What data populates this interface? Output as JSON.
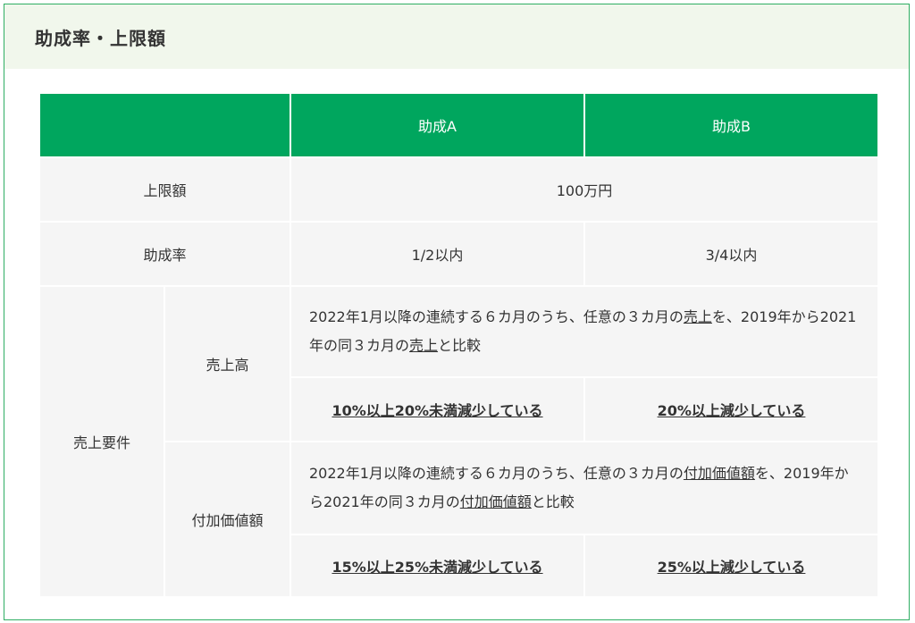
{
  "header": {
    "title": "助成率・上限額"
  },
  "table": {
    "columns": [
      "",
      "助成A",
      "助成B"
    ],
    "limit": {
      "label": "上限額",
      "value": "100万円"
    },
    "rate": {
      "label": "助成率",
      "a": "1/2以内",
      "b": "3/4以内"
    },
    "requirements": {
      "label": "売上要件",
      "sales": {
        "label": "売上高",
        "desc_part1": "2022年1月以降の連続する６カ月のうち、任意の３カ月の",
        "desc_term1": "売上",
        "desc_part2": "を、2019年から2021年の同３カ月の",
        "desc_term2": "売上",
        "desc_part3": "と比較",
        "a": "10%以上20%未満減少している",
        "b": "20%以上減少している"
      },
      "value_added": {
        "label": "付加価値額",
        "desc_part1": "2022年1月以降の連続する６カ月のうち、任意の３カ月の",
        "desc_term1": "付加価値額",
        "desc_part2": "を、2019年から2021年の同３カ月の",
        "desc_term2": "付加価値額",
        "desc_part3": "と比較",
        "a": "15%以上25%未満減少している",
        "b": "25%以上減少している"
      }
    }
  },
  "colors": {
    "accent": "#00a65e",
    "header_bg": "#f1f7ec",
    "border": "#2fae63",
    "cell_bg": "#f5f5f5"
  }
}
